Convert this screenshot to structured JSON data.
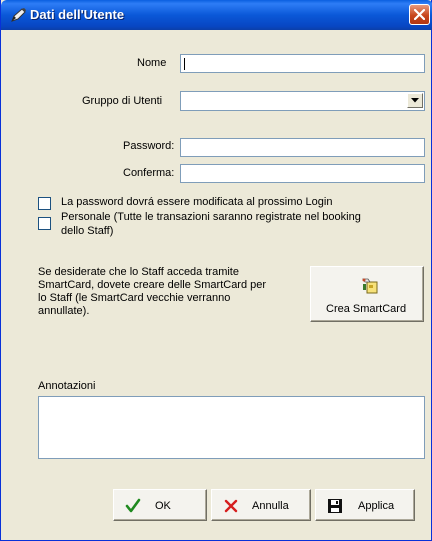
{
  "window": {
    "title": "Dati dell'Utente"
  },
  "form": {
    "nome_label": "Nome",
    "nome_value": "",
    "gruppo_label": "Gruppo di Utenti",
    "gruppo_value": "",
    "password_label": "Password:",
    "password_value": "",
    "conferma_label": "Conferma:",
    "conferma_value": ""
  },
  "checkboxes": [
    {
      "label": "La password dovrá essere modificata al prossimo Login",
      "checked": false
    },
    {
      "label_line1": "Personale (Tutte le transazioni saranno registrate nel booking",
      "label_line2": "dello Staff)",
      "checked": false
    }
  ],
  "smartcard": {
    "info_lines": [
      "Se desiderate che lo Staff acceda tramite",
      "SmartCard, dovete creare delle SmartCard per",
      "lo Staff (le SmartCard vecchie verranno",
      "annullate)."
    ],
    "button_label": "Crea SmartCard",
    "button_icon": "smartcard-icon"
  },
  "notes": {
    "label": "Annotazioni",
    "value": ""
  },
  "buttons": {
    "ok_label": "OK",
    "ok_icon": "checkmark-icon",
    "cancel_label": "Annulla",
    "cancel_icon": "x-icon",
    "apply_label": "Applica",
    "apply_icon": "floppy-disk-icon"
  },
  "colors": {
    "titlebar": "#0A58D8",
    "ok_green": "#1F8A1F",
    "cancel_red": "#D61E1E"
  }
}
